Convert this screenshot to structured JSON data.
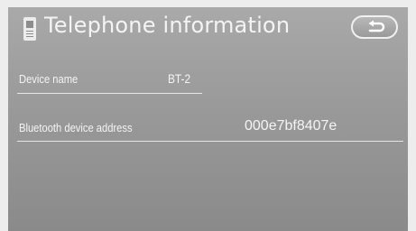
{
  "header": {
    "title": "Telephone information",
    "icon": "telephone-icon",
    "back_icon": "return-arrow-icon"
  },
  "rows": [
    {
      "label": "Device name",
      "value": "BT-2"
    },
    {
      "label": "Bluetooth device address",
      "value": "000e7bf8407e"
    }
  ],
  "colors": {
    "screen_background": "#9b9b9b",
    "text": "#f4f4f4"
  }
}
